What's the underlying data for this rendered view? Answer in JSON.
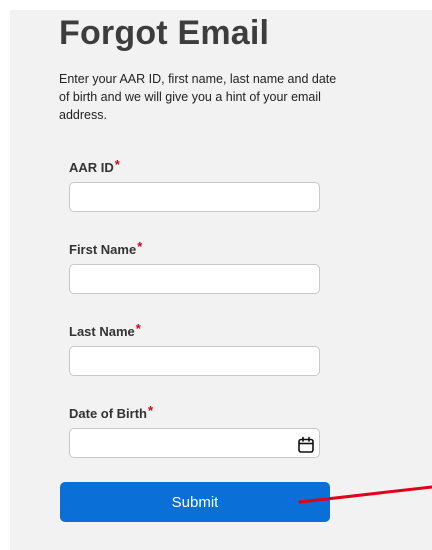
{
  "form": {
    "title": "Forgot Email",
    "description": "Enter your AAR ID, first name, last name and date of birth and we will give you a hint of your email address.",
    "required_marker": "*",
    "fields": [
      {
        "label": "AAR ID",
        "value": "",
        "placeholder": ""
      },
      {
        "label": "First Name",
        "value": "",
        "placeholder": ""
      },
      {
        "label": "Last Name",
        "value": "",
        "placeholder": ""
      },
      {
        "label": "Date of Birth",
        "value": "",
        "placeholder": "",
        "icon": "calendar-icon"
      }
    ],
    "submit_label": "Submit"
  },
  "colors": {
    "panel_background": "#f2f2f2",
    "title": "#3d3d3d",
    "required": "#d0021b",
    "button": "#0a6fd6",
    "button_text": "#ffffff",
    "annotation_arrow": "#e0001b"
  }
}
